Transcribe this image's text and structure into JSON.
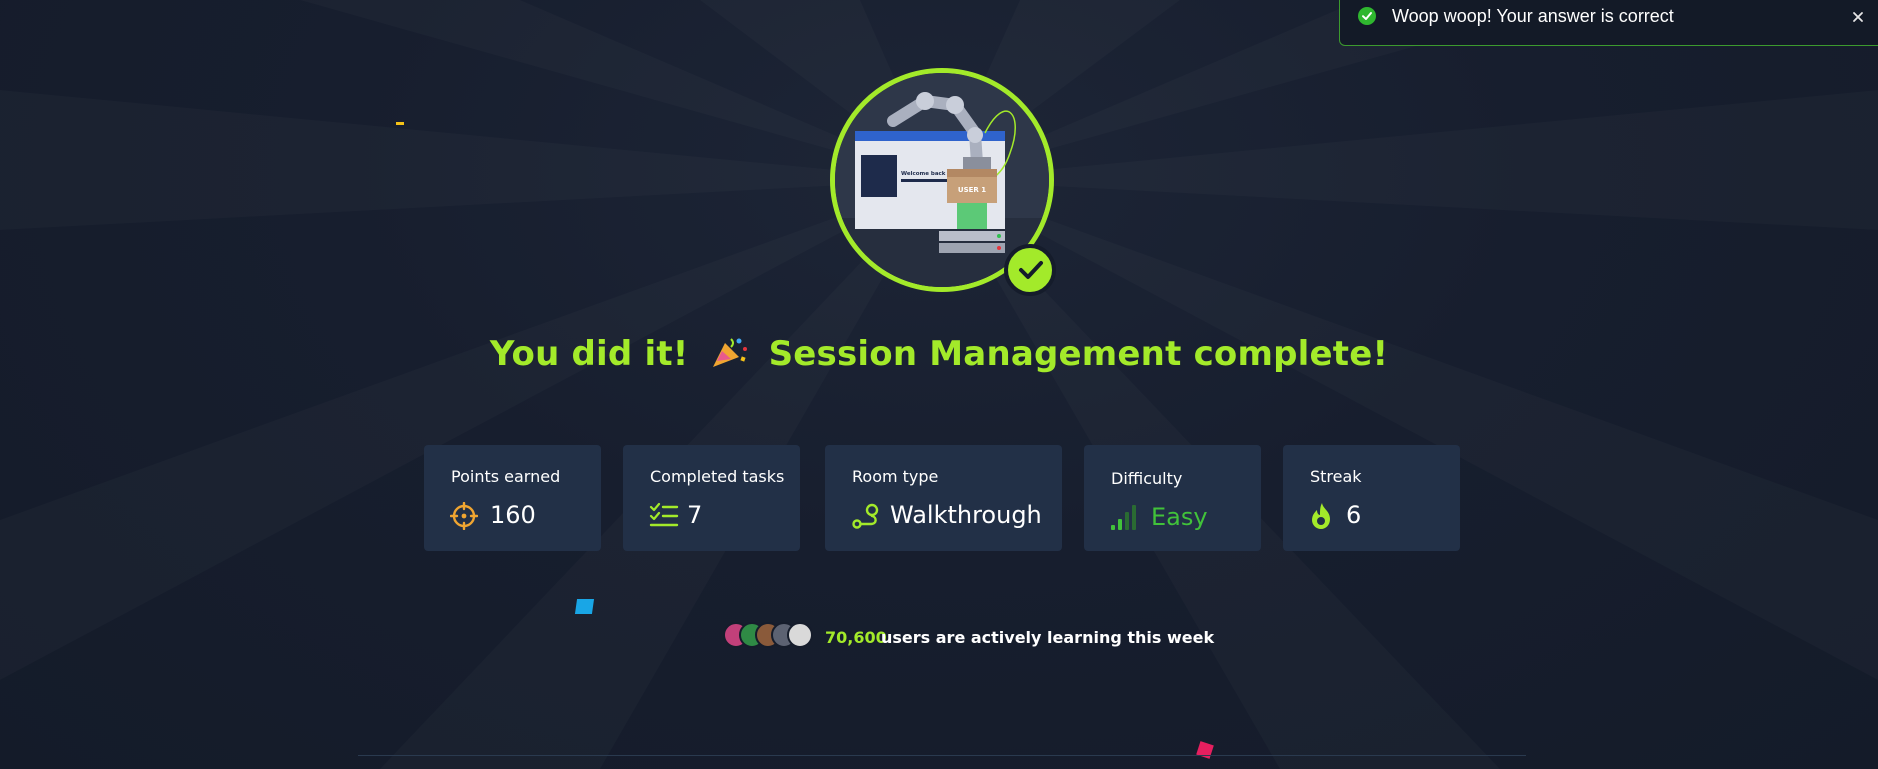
{
  "toast": {
    "message": "Woop woop! Your answer is correct",
    "status": "success",
    "icon": "check-circle-icon",
    "close_icon": "close-icon"
  },
  "hero": {
    "illustration": "robot-arm-delivering-user-box-illustration",
    "screen_text": "Welcome back \"USER\"",
    "box_label": "USER 1",
    "badge_icon": "checkmark-icon"
  },
  "headline": {
    "part1": "You did it!",
    "emoji": "party-popper-icon",
    "part2": "Session Management complete!"
  },
  "stats": [
    {
      "label": "Points earned",
      "value": "160",
      "icon": "target-icon"
    },
    {
      "label": "Completed tasks",
      "value": "7",
      "icon": "task-list-icon"
    },
    {
      "label": "Room type",
      "value": "Walkthrough",
      "icon": "route-icon"
    },
    {
      "label": "Difficulty",
      "value": "Easy",
      "icon": "signal-bars-icon"
    },
    {
      "label": "Streak",
      "value": "6",
      "icon": "flame-icon"
    }
  ],
  "community": {
    "count": "70,600",
    "text": "users are actively learning this week",
    "avatars": [
      "avatar-1",
      "avatar-2",
      "avatar-3",
      "avatar-4",
      "avatar-5"
    ]
  },
  "colors": {
    "accent": "#a3ea2a",
    "background": "#151c2b",
    "card": "#223047",
    "success": "#2fb72f",
    "easy": "#41c23a",
    "points_icon": "#f0a531"
  }
}
